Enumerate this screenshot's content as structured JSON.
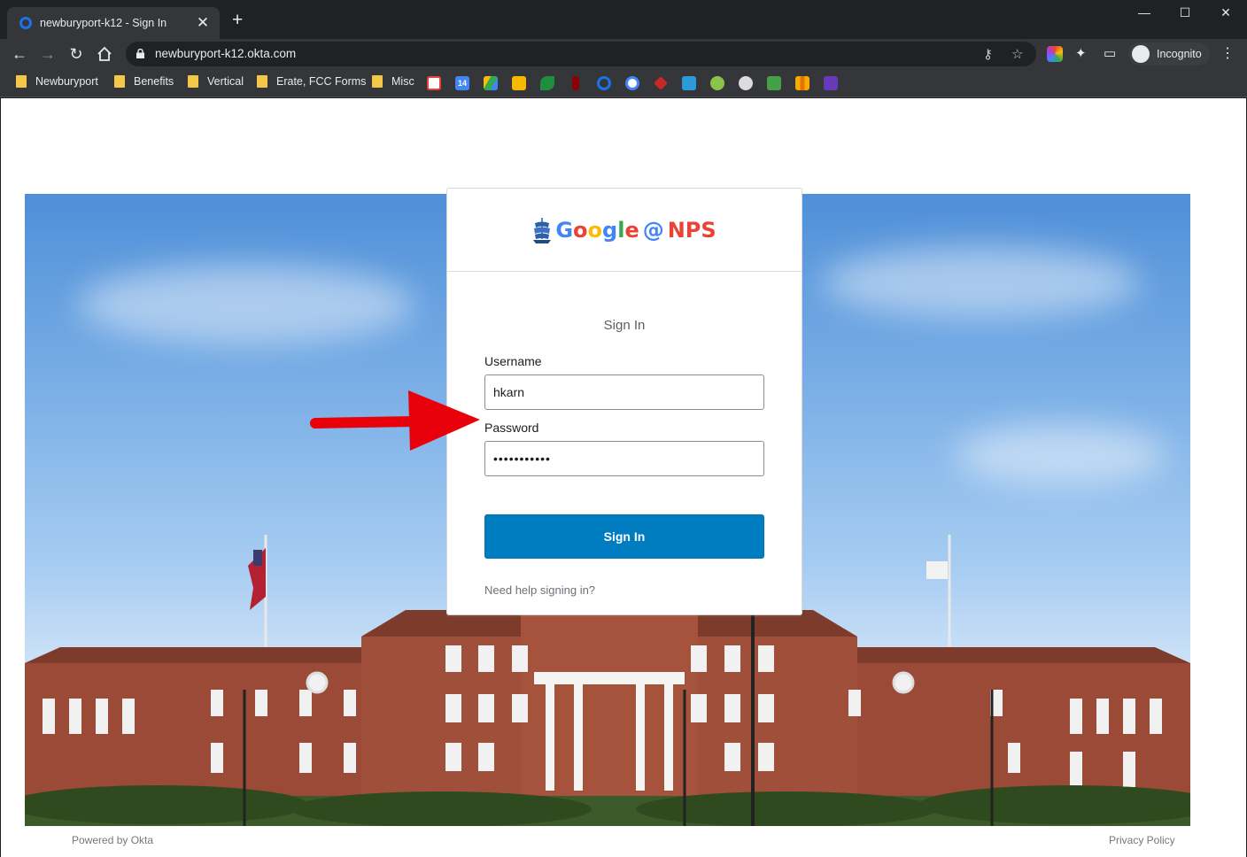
{
  "browser": {
    "tab_title": "newburyport-k12 - Sign In",
    "url": "newburyport-k12.okta.com",
    "profile_label": "Incognito",
    "bookmark_folders": [
      "Newburyport",
      "Benefits",
      "Vertical",
      "Erate, FCC Forms",
      "Misc"
    ],
    "gcal_day": "14"
  },
  "card": {
    "logo": {
      "brand": "Google",
      "at": "@",
      "org": "NPS"
    },
    "title": "Sign In",
    "username_label": "Username",
    "username_value": "hkarn",
    "password_label": "Password",
    "password_value": "•••••••••••",
    "submit_label": "Sign In",
    "help_link": "Need help signing in?"
  },
  "footer": {
    "powered_by": "Powered by Okta",
    "privacy": "Privacy Policy"
  },
  "colors": {
    "primary_button": "#007dc1",
    "annotation_arrow": "#e8000b",
    "google_blue": "#4285F4",
    "google_red": "#EA4335",
    "google_yellow": "#FBBC05",
    "google_green": "#34A853"
  }
}
